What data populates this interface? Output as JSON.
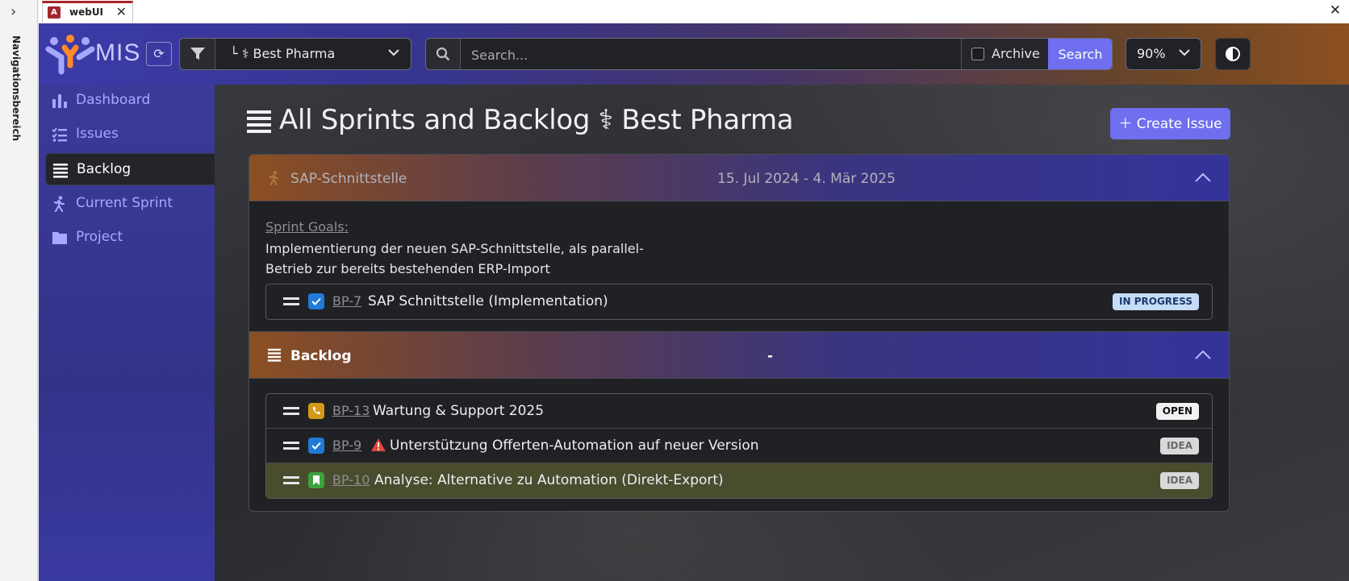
{
  "chrome": {
    "nav_pane_label": "Navigationsbereich",
    "tab_title": "webUI",
    "tab_icon_letter": "A",
    "close_glyph": "✕",
    "expand_glyph": "›"
  },
  "header": {
    "logo_text": "MIS",
    "project_filter": "└ ⚕ Best Pharma",
    "search_placeholder": "Search...",
    "archive_label": "Archive",
    "search_button": "Search",
    "zoom": "90%"
  },
  "sidebar": {
    "items": [
      {
        "label": "Dashboard",
        "icon": "bar-chart-icon"
      },
      {
        "label": "Issues",
        "icon": "checklist-icon"
      },
      {
        "label": "Backlog",
        "icon": "list-icon"
      },
      {
        "label": "Current Sprint",
        "icon": "running-person-icon"
      },
      {
        "label": "Project",
        "icon": "folder-icon"
      }
    ],
    "active_index": 2
  },
  "main": {
    "title": "All Sprints and Backlog ⚕ Best Pharma",
    "create_button": "Create Issue",
    "sprint": {
      "name": "SAP-Schnittstelle",
      "dates": "15. Jul 2024 - 4. Mär 2025",
      "goals_label": "Sprint Goals:",
      "goals_line1": "Implementierung der neuen SAP-Schnittstelle, als parallel-",
      "goals_line2": "Betrieb zur bereits bestehenden ERP-Import",
      "issues": [
        {
          "key": "BP-7",
          "title": "SAP Schnittstelle (Implementation)",
          "status": "IN PROGRESS",
          "type": "task"
        }
      ]
    },
    "backlog": {
      "name": "Backlog",
      "middle": "-",
      "issues": [
        {
          "key": "BP-13",
          "title": "Wartung & Support 2025",
          "status": "OPEN",
          "type": "support"
        },
        {
          "key": "BP-9",
          "title": "Unterstützung Offerten-Automation auf neuer Version",
          "status": "IDEA",
          "type": "task",
          "warning": true
        },
        {
          "key": "BP-10",
          "title": "Analyse: Alternative zu Automation (Direkt-Export)",
          "status": "IDEA",
          "type": "story"
        }
      ]
    }
  },
  "colors": {
    "accent": "#6f6ff0",
    "sidebar": "#3b3a9a",
    "in_progress_badge": "#c6dcf5",
    "task_icon": "#1f7ad8",
    "support_icon": "#d29a16",
    "story_icon": "#3ba33b",
    "warning": "#e0463a"
  }
}
